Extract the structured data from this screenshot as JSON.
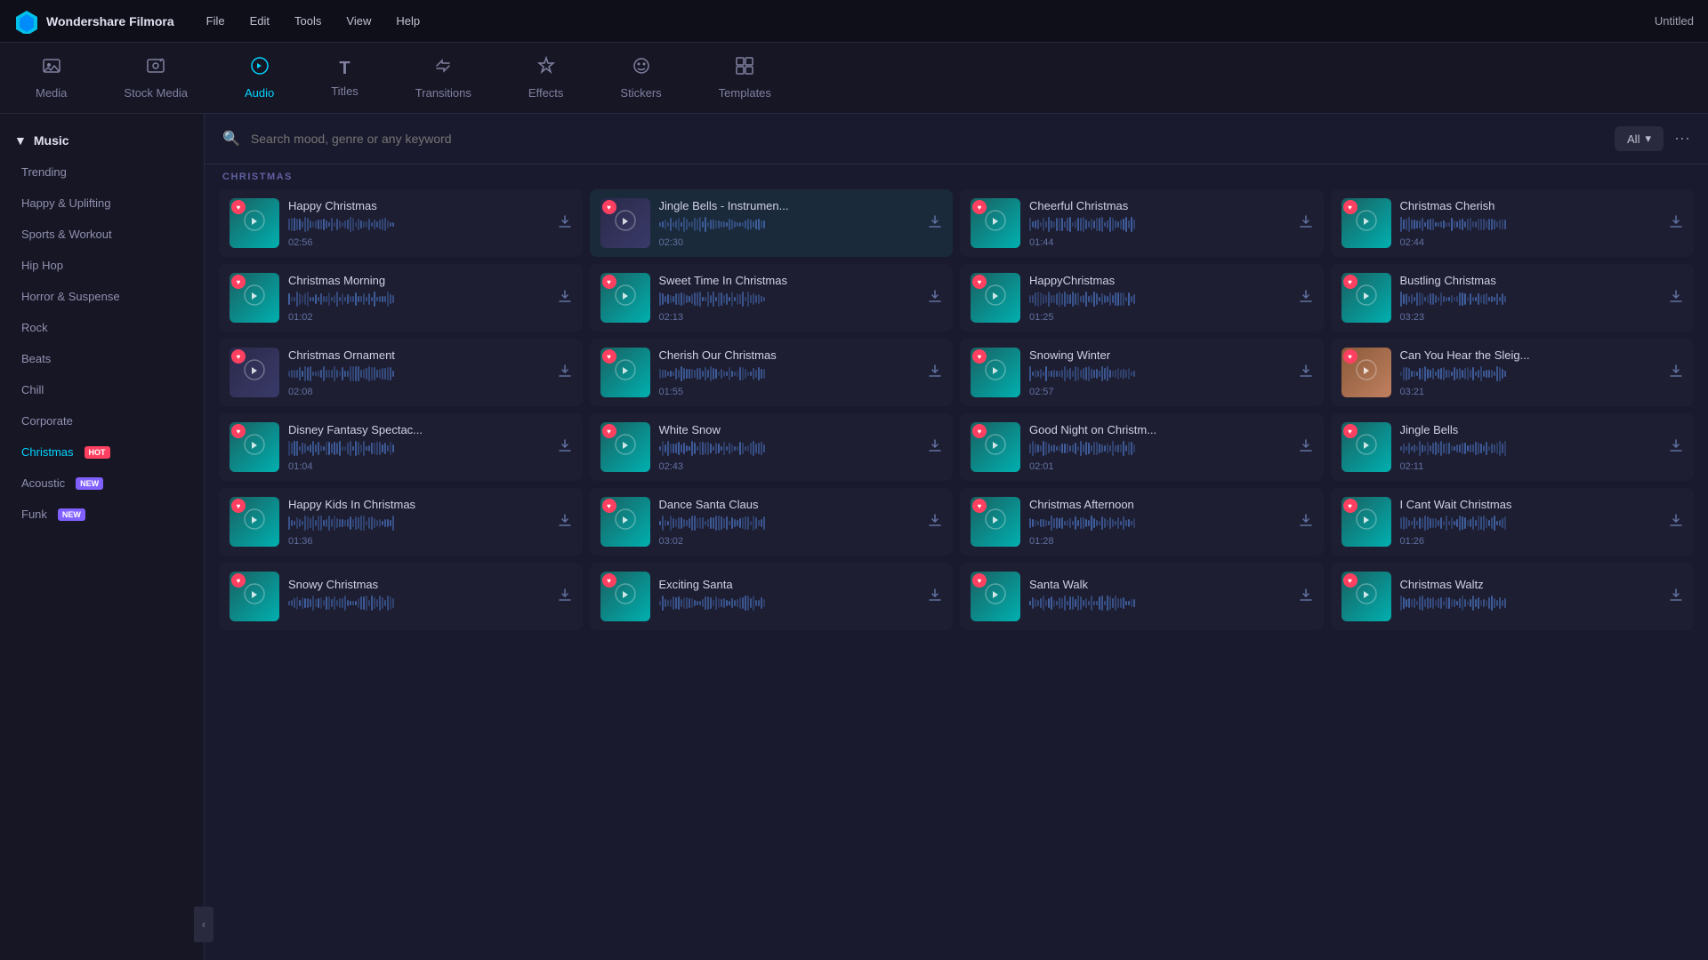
{
  "app": {
    "name": "Wondershare Filmora",
    "window_title": "Untitled"
  },
  "menu": {
    "items": [
      "File",
      "Edit",
      "Tools",
      "View",
      "Help"
    ]
  },
  "toolbar": {
    "items": [
      {
        "id": "media",
        "label": "Media",
        "icon": "🎞",
        "active": false
      },
      {
        "id": "stock-media",
        "label": "Stock Media",
        "icon": "📷",
        "active": false
      },
      {
        "id": "audio",
        "label": "Audio",
        "icon": "🎵",
        "active": true
      },
      {
        "id": "titles",
        "label": "Titles",
        "icon": "T",
        "active": false
      },
      {
        "id": "transitions",
        "label": "Transitions",
        "icon": "↔",
        "active": false
      },
      {
        "id": "effects",
        "label": "Effects",
        "icon": "✨",
        "active": false
      },
      {
        "id": "stickers",
        "label": "Stickers",
        "icon": "🎀",
        "active": false
      },
      {
        "id": "templates",
        "label": "Templates",
        "icon": "▦",
        "active": false
      }
    ]
  },
  "sidebar": {
    "header": "Music",
    "items": [
      {
        "id": "trending",
        "label": "Trending",
        "active": false
      },
      {
        "id": "happy",
        "label": "Happy & Uplifting",
        "active": false
      },
      {
        "id": "sports",
        "label": "Sports & Workout",
        "active": false
      },
      {
        "id": "hiphop",
        "label": "Hip Hop",
        "active": false
      },
      {
        "id": "horror",
        "label": "Horror & Suspense",
        "active": false
      },
      {
        "id": "rock",
        "label": "Rock",
        "active": false
      },
      {
        "id": "beats",
        "label": "Beats",
        "active": false
      },
      {
        "id": "chill",
        "label": "Chill",
        "active": false
      },
      {
        "id": "corporate",
        "label": "Corporate",
        "active": false
      },
      {
        "id": "christmas",
        "label": "Christmas",
        "badge": "HOT",
        "badge_type": "hot",
        "active": true
      },
      {
        "id": "acoustic",
        "label": "Acoustic",
        "badge": "NEW",
        "badge_type": "new",
        "active": false
      },
      {
        "id": "funk",
        "label": "Funk",
        "badge": "NEW",
        "badge_type": "new",
        "active": false
      }
    ]
  },
  "search": {
    "placeholder": "Search mood, genre or any keyword",
    "filter_label": "All"
  },
  "section_label": "CHRISTMAS",
  "music_items": [
    {
      "id": 1,
      "title": "Happy Christmas",
      "duration": "02:56",
      "thumb": "teal",
      "hearted": true
    },
    {
      "id": 2,
      "title": "Jingle Bells - Instrumen...",
      "duration": "02:30",
      "thumb": "dark",
      "hearted": true
    },
    {
      "id": 3,
      "title": "Cheerful Christmas",
      "duration": "01:44",
      "thumb": "teal",
      "hearted": true
    },
    {
      "id": 4,
      "title": "Christmas Cherish",
      "duration": "02:44",
      "thumb": "teal",
      "hearted": true
    },
    {
      "id": 5,
      "title": "Christmas Morning",
      "duration": "01:02",
      "thumb": "teal",
      "hearted": true
    },
    {
      "id": 6,
      "title": "Sweet Time In Christmas",
      "duration": "02:13",
      "thumb": "teal",
      "hearted": true
    },
    {
      "id": 7,
      "title": "HappyChristmas",
      "duration": "01:25",
      "thumb": "teal",
      "hearted": true
    },
    {
      "id": 8,
      "title": "Bustling Christmas",
      "duration": "03:23",
      "thumb": "teal",
      "hearted": true
    },
    {
      "id": 9,
      "title": "Christmas Ornament",
      "duration": "02:08",
      "thumb": "dark",
      "hearted": true
    },
    {
      "id": 10,
      "title": "Cherish Our Christmas",
      "duration": "01:55",
      "thumb": "teal",
      "hearted": true
    },
    {
      "id": 11,
      "title": "Snowing Winter",
      "duration": "02:57",
      "thumb": "teal",
      "hearted": true
    },
    {
      "id": 12,
      "title": "Can You Hear the Sleig...",
      "duration": "03:21",
      "thumb": "photo",
      "hearted": true
    },
    {
      "id": 13,
      "title": "Disney Fantasy Spectac...",
      "duration": "01:04",
      "thumb": "teal",
      "hearted": true
    },
    {
      "id": 14,
      "title": "White Snow",
      "duration": "02:43",
      "thumb": "teal",
      "hearted": true
    },
    {
      "id": 15,
      "title": "Good Night on Christm...",
      "duration": "02:01",
      "thumb": "teal",
      "hearted": true
    },
    {
      "id": 16,
      "title": "Jingle Bells",
      "duration": "02:11",
      "thumb": "teal",
      "hearted": true
    },
    {
      "id": 17,
      "title": "Happy Kids In Christmas",
      "duration": "01:36",
      "thumb": "teal",
      "hearted": true
    },
    {
      "id": 18,
      "title": "Dance Santa Claus",
      "duration": "03:02",
      "thumb": "teal",
      "hearted": true
    },
    {
      "id": 19,
      "title": "Christmas Afternoon",
      "duration": "01:28",
      "thumb": "teal",
      "hearted": true
    },
    {
      "id": 20,
      "title": "I Cant Wait Christmas",
      "duration": "01:26",
      "thumb": "teal",
      "hearted": true
    },
    {
      "id": 21,
      "title": "Snowy Christmas",
      "duration": "",
      "thumb": "teal",
      "hearted": true
    },
    {
      "id": 22,
      "title": "Exciting Santa",
      "duration": "",
      "thumb": "teal",
      "hearted": true
    },
    {
      "id": 23,
      "title": "Santa Walk",
      "duration": "",
      "thumb": "teal",
      "hearted": true
    },
    {
      "id": 24,
      "title": "Christmas Waltz",
      "duration": "",
      "thumb": "teal",
      "hearted": true
    }
  ]
}
